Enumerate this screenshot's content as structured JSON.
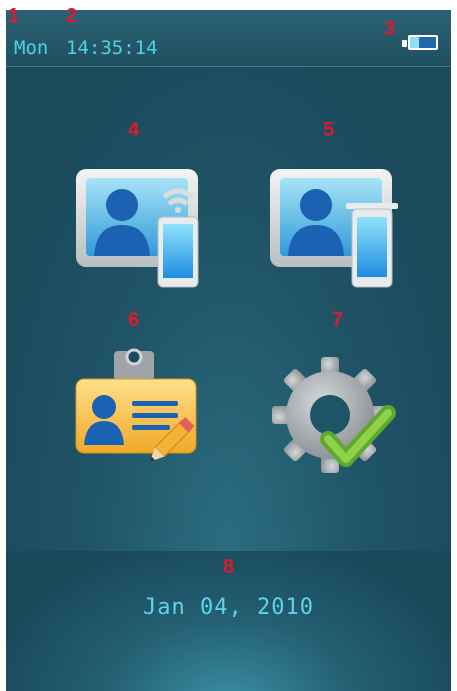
{
  "status_bar": {
    "day": "Mon",
    "time": "14:35:14",
    "battery_level_fraction": 0.33,
    "battery_icon": "battery-icon"
  },
  "menu": {
    "items": [
      {
        "marker": "4",
        "icon": "user-phone-wifi-icon"
      },
      {
        "marker": "5",
        "icon": "user-phone-icon"
      },
      {
        "marker": "6",
        "icon": "id-badge-edit-icon"
      },
      {
        "marker": "7",
        "icon": "settings-check-icon"
      }
    ]
  },
  "footer": {
    "date": "Jan 04, 2010"
  },
  "markers": {
    "day": "1",
    "time": "2",
    "battery": "3",
    "date": "8"
  },
  "colors": {
    "background": "#1c4b5e",
    "status_text": "#4fd0ea",
    "date_text": "#5fd3ea",
    "marker": "#e01a2a"
  }
}
